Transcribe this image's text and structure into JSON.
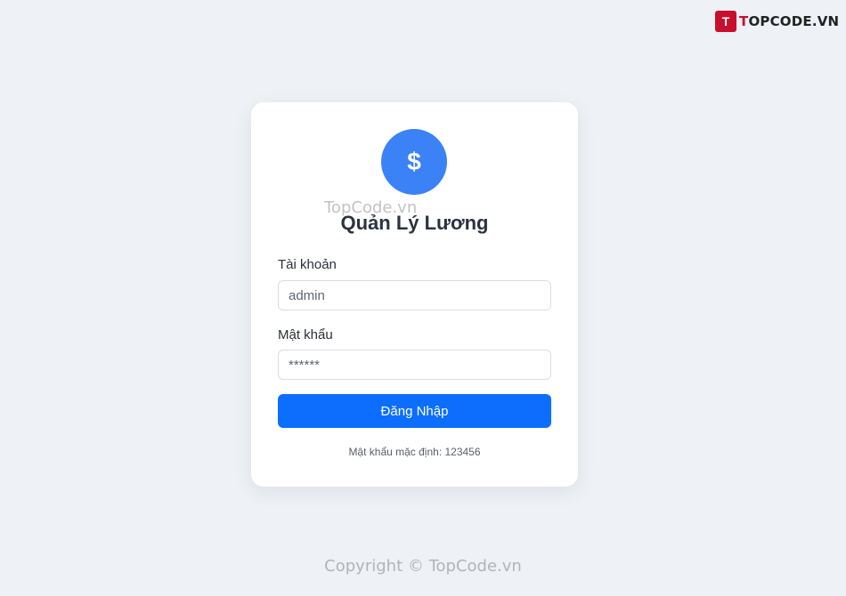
{
  "brand": {
    "mark": "T",
    "name_prefix": "T",
    "name_rest": "OPCODE.VN"
  },
  "watermark": {
    "card": "TopCode.vn",
    "footer": "Copyright © TopCode.vn"
  },
  "login": {
    "avatar_symbol": "$",
    "title": "Quản Lý Lương",
    "username_label": "Tài khoản",
    "username_value": "admin",
    "password_label": "Mật khẩu",
    "password_value": "******",
    "submit_label": "Đăng Nhập",
    "hint": "Mật khẩu mặc định: 123456"
  },
  "colors": {
    "background": "#eef1f5",
    "primary": "#0d6efd",
    "avatar": "#3b82f6",
    "brand": "#c8102e"
  }
}
